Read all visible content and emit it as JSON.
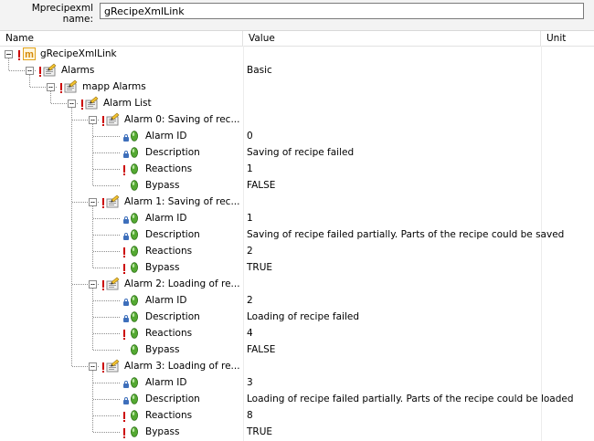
{
  "topbar": {
    "label_line1": "Mprecipexml",
    "label_line2": "name:",
    "input_value": "gRecipeXmlLink"
  },
  "header": {
    "name": "Name",
    "value": "Value",
    "unit": "Unit"
  },
  "tree": [
    {
      "name": "gRecipeXmlLink",
      "value": "",
      "level": 0,
      "icon": "module-icon",
      "toggle": true,
      "mark": true
    },
    {
      "name": "Alarms",
      "value": "Basic",
      "level": 1,
      "icon": "folder-pencil-icon",
      "toggle": true,
      "mark": true
    },
    {
      "name": "mapp Alarms",
      "value": "",
      "level": 2,
      "icon": "folder-pencil-icon",
      "toggle": true,
      "mark": true
    },
    {
      "name": "Alarm List",
      "value": "",
      "level": 3,
      "icon": "folder-pencil-icon",
      "toggle": true,
      "mark": true
    },
    {
      "name": "Alarm 0: Saving of rec...",
      "value": "",
      "level": 4,
      "icon": "folder-pencil-icon",
      "toggle": true,
      "mark": true
    },
    {
      "name": "Alarm ID",
      "value": "0",
      "level": 5,
      "icon": "parameter-icon",
      "lock": true
    },
    {
      "name": "Description",
      "value": "Saving of recipe failed",
      "level": 5,
      "icon": "parameter-icon",
      "lock": true
    },
    {
      "name": "Reactions",
      "value": "1",
      "level": 5,
      "icon": "parameter-icon",
      "mark": true
    },
    {
      "name": "Bypass",
      "value": "FALSE",
      "level": 5,
      "icon": "parameter-icon",
      "last": true
    },
    {
      "name": "Alarm 1: Saving of rec...",
      "value": "",
      "level": 4,
      "icon": "folder-pencil-icon",
      "toggle": true,
      "mark": true
    },
    {
      "name": "Alarm ID",
      "value": "1",
      "level": 5,
      "icon": "parameter-icon",
      "lock": true
    },
    {
      "name": "Description",
      "value": "Saving of recipe failed partially. Parts of the recipe could be saved",
      "level": 5,
      "icon": "parameter-icon",
      "lock": true
    },
    {
      "name": "Reactions",
      "value": "2",
      "level": 5,
      "icon": "parameter-icon",
      "mark": true
    },
    {
      "name": "Bypass",
      "value": "TRUE",
      "level": 5,
      "icon": "parameter-icon",
      "mark": true,
      "last": true
    },
    {
      "name": "Alarm 2: Loading of re...",
      "value": "",
      "level": 4,
      "icon": "folder-pencil-icon",
      "toggle": true,
      "mark": true
    },
    {
      "name": "Alarm ID",
      "value": "2",
      "level": 5,
      "icon": "parameter-icon",
      "lock": true
    },
    {
      "name": "Description",
      "value": "Loading of recipe failed",
      "level": 5,
      "icon": "parameter-icon",
      "lock": true
    },
    {
      "name": "Reactions",
      "value": "4",
      "level": 5,
      "icon": "parameter-icon",
      "mark": true
    },
    {
      "name": "Bypass",
      "value": "FALSE",
      "level": 5,
      "icon": "parameter-icon",
      "last": true
    },
    {
      "name": "Alarm 3: Loading of re...",
      "value": "",
      "level": 4,
      "icon": "folder-pencil-icon",
      "toggle": true,
      "mark": true
    },
    {
      "name": "Alarm ID",
      "value": "3",
      "level": 5,
      "icon": "parameter-icon",
      "lock": true
    },
    {
      "name": "Description",
      "value": "Loading of recipe failed partially. Parts of the recipe could be loaded",
      "level": 5,
      "icon": "parameter-icon",
      "lock": true
    },
    {
      "name": "Reactions",
      "value": "8",
      "level": 5,
      "icon": "parameter-icon",
      "mark": true
    },
    {
      "name": "Bypass",
      "value": "TRUE",
      "level": 5,
      "icon": "parameter-icon",
      "mark": true
    }
  ]
}
